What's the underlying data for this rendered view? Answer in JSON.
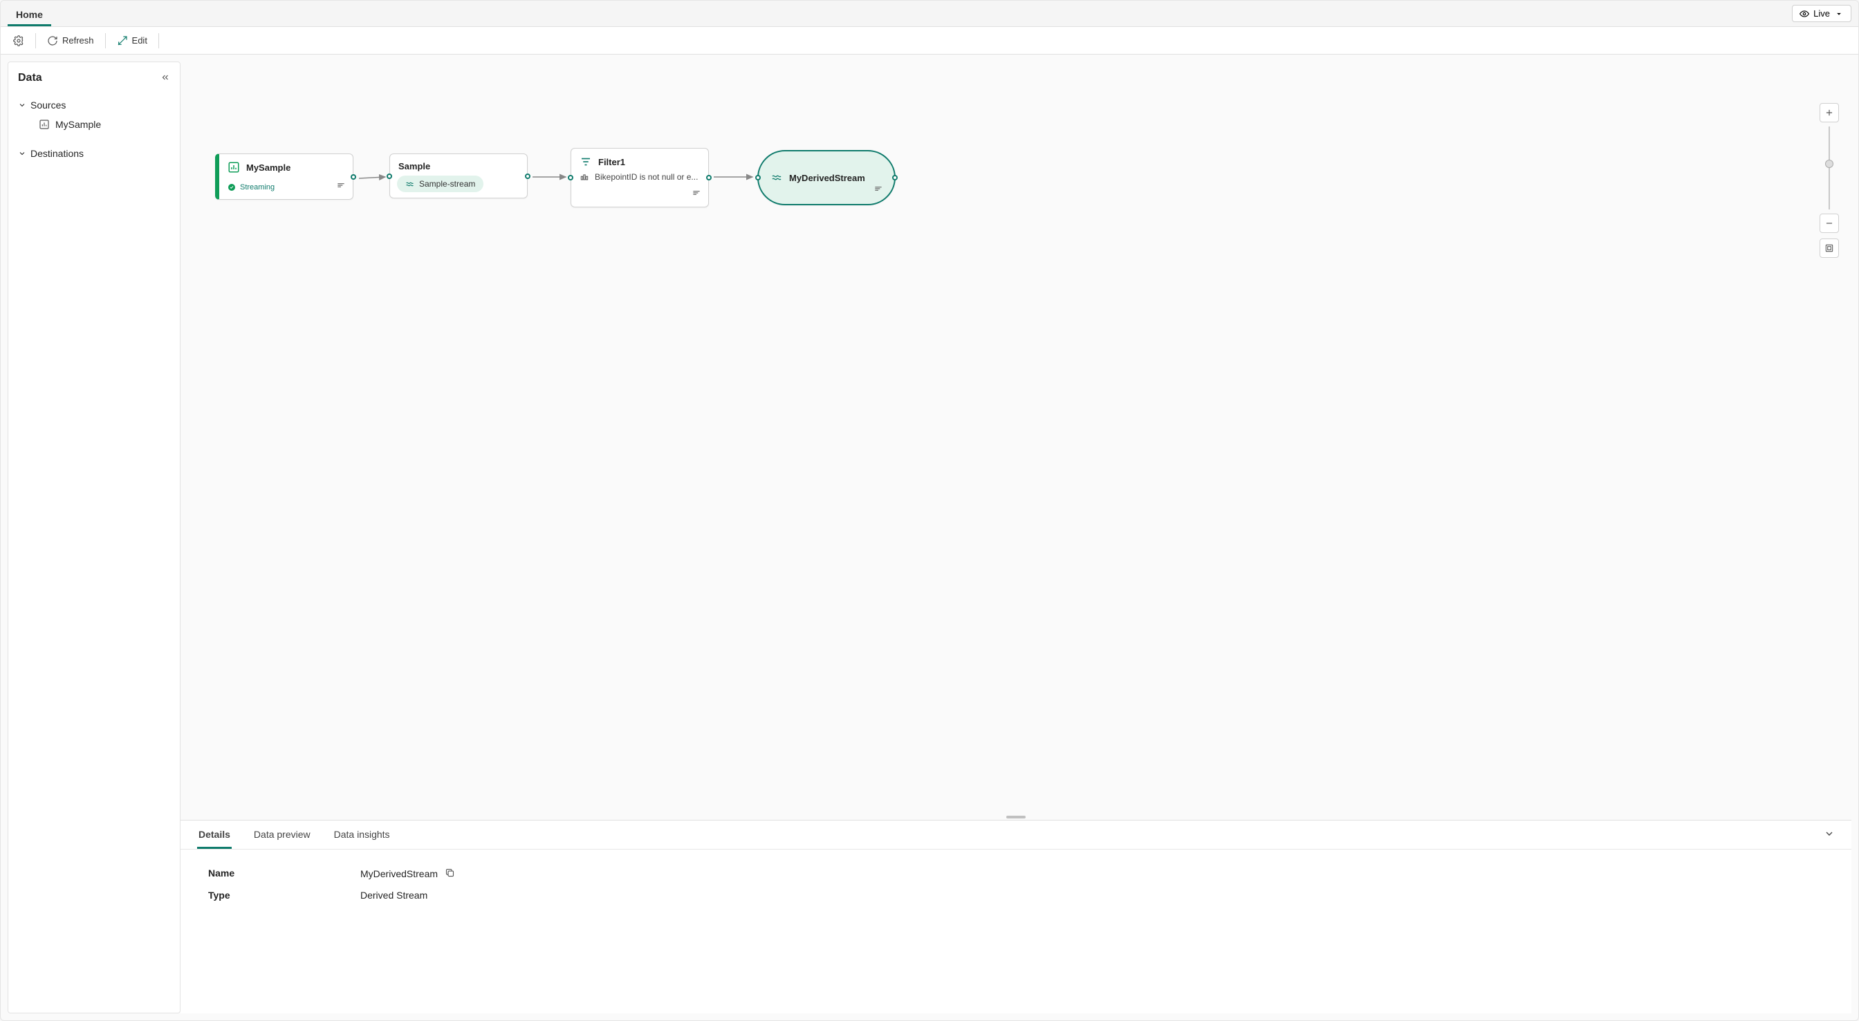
{
  "ribbon": {
    "tabs": [
      {
        "label": "Home",
        "active": true
      }
    ],
    "live_label": "Live"
  },
  "toolbar": {
    "refresh_label": "Refresh",
    "edit_label": "Edit"
  },
  "sidebar": {
    "title": "Data",
    "sources_label": "Sources",
    "destinations_label": "Destinations",
    "sources": [
      {
        "label": "MySample"
      }
    ]
  },
  "flow": {
    "nodes": {
      "source": {
        "title": "MySample",
        "status": "Streaming"
      },
      "sample": {
        "title": "Sample",
        "pill": "Sample-stream"
      },
      "filter": {
        "title": "Filter1",
        "expr": "BikepointID is not null or e..."
      },
      "derived": {
        "title": "MyDerivedStream"
      }
    }
  },
  "bottom": {
    "tabs": {
      "details": "Details",
      "preview": "Data preview",
      "insights": "Data insights"
    },
    "fields": {
      "name_label": "Name",
      "name_value": "MyDerivedStream",
      "type_label": "Type",
      "type_value": "Derived Stream"
    }
  }
}
